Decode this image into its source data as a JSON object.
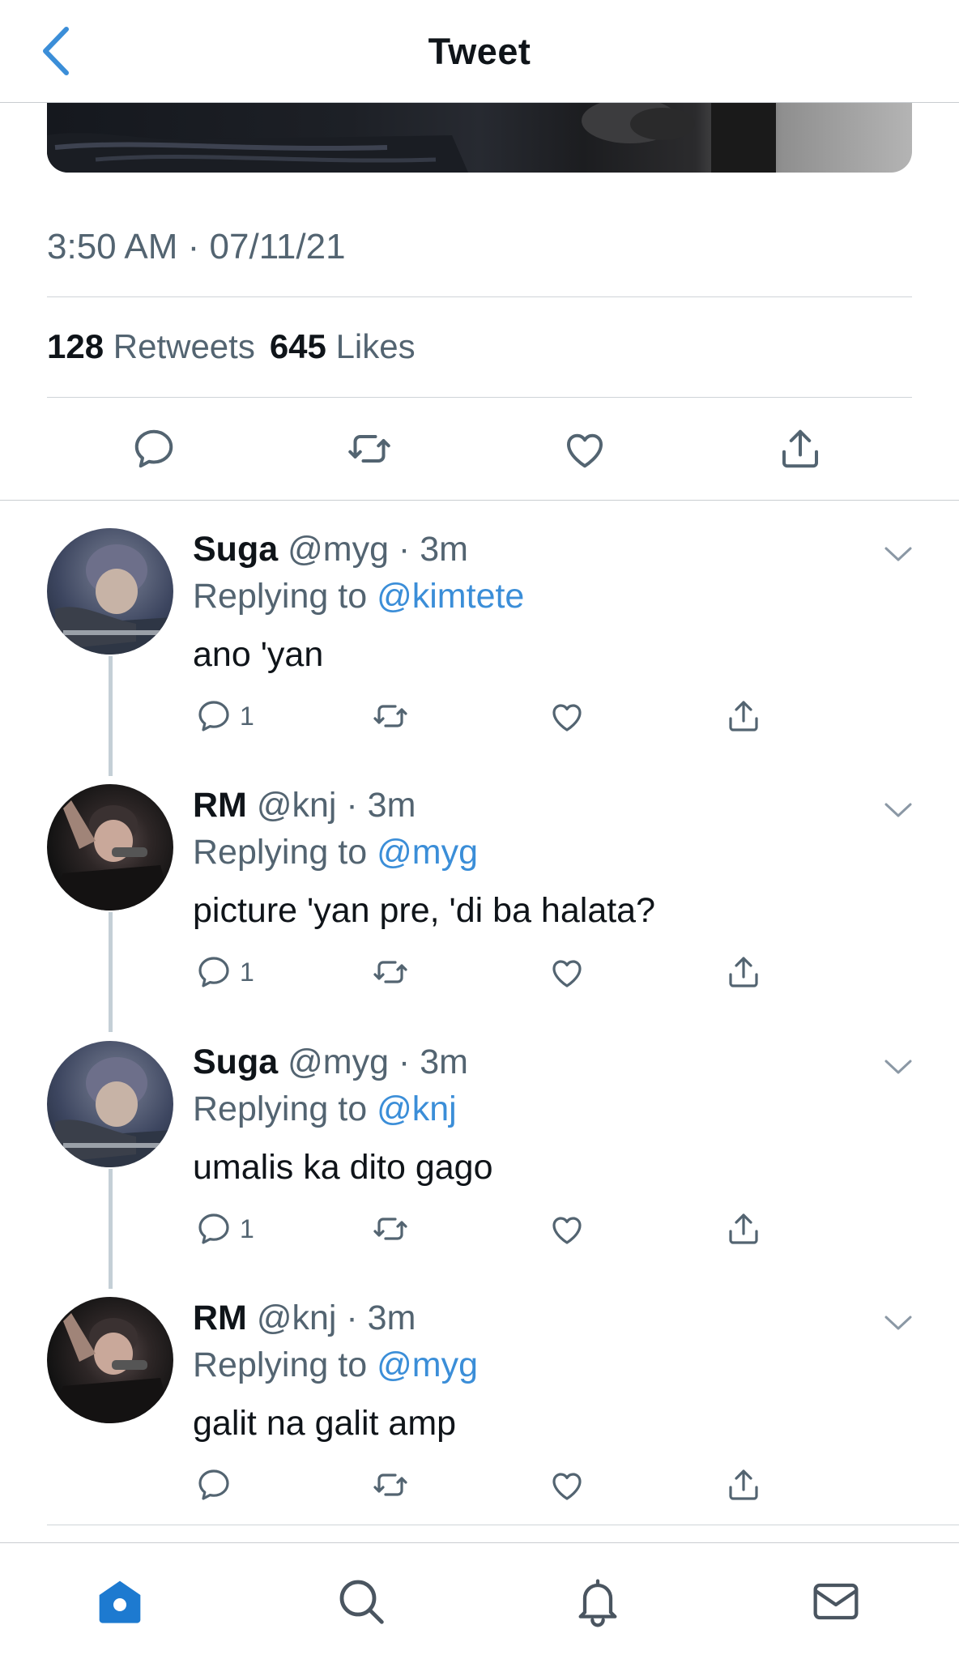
{
  "header": {
    "title": "Tweet"
  },
  "tweet": {
    "timestamp": "3:50 AM · 07/11/21",
    "retweets_count": "128",
    "retweets_label": "Retweets",
    "likes_count": "645",
    "likes_label": "Likes"
  },
  "replies": [
    {
      "name": "Suga",
      "meta": "@myg · 3m",
      "replying_prefix": "Replying to",
      "replying_to": "@kimtete",
      "text": "ano 'yan",
      "reply_count": "1"
    },
    {
      "name": "RM",
      "meta": "@knj · 3m",
      "replying_prefix": "Replying to",
      "replying_to": "@myg",
      "text": "picture 'yan pre, 'di ba halata?",
      "reply_count": "1"
    },
    {
      "name": "Suga",
      "meta": "@myg · 3m",
      "replying_prefix": "Replying to",
      "replying_to": "@knj",
      "text": "umalis ka dito gago",
      "reply_count": "1"
    },
    {
      "name": "RM",
      "meta": "@knj · 3m",
      "replying_prefix": "Replying to",
      "replying_to": "@myg",
      "text": "galit na galit amp",
      "reply_count": ""
    }
  ],
  "tabbar": {
    "active": "home",
    "tabs": [
      "home-icon",
      "search-icon",
      "bell-icon",
      "mail-icon"
    ]
  },
  "colors": {
    "accent": "#3b8ed8",
    "secondary_text": "#536471",
    "tab_active": "#1d7ad0"
  }
}
